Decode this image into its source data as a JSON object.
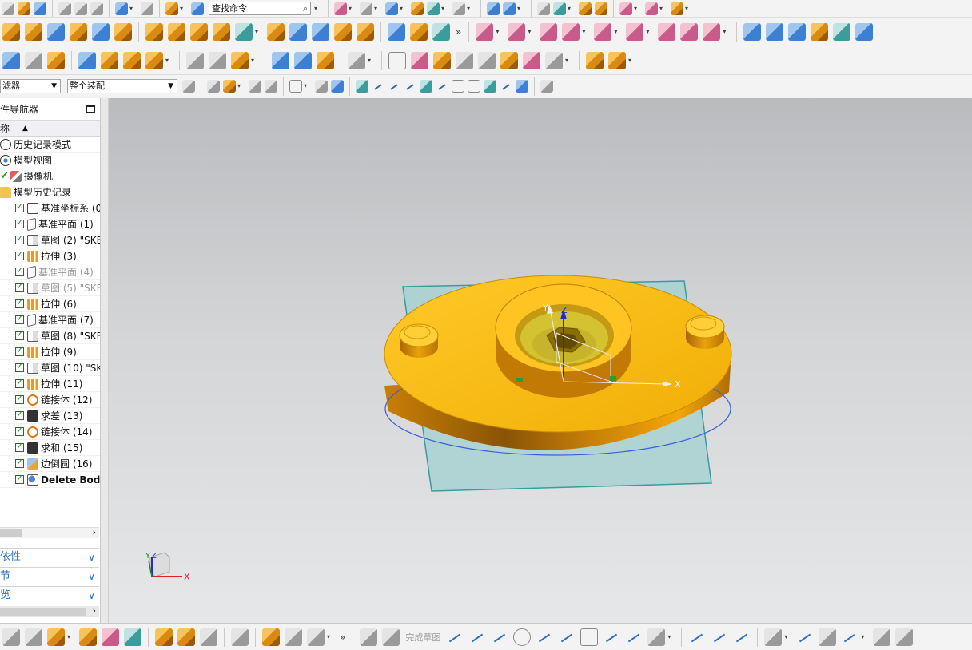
{
  "toolbar": {
    "search_placeholder": "查找命令",
    "filter_value": "滤器",
    "assembly_value": "整个装配",
    "finish_sketch_label": "完成草图",
    "more_glyph": "»"
  },
  "navigator": {
    "title": "件导航器",
    "column_name": "称",
    "top_items": [
      {
        "label": "历史记录模式"
      },
      {
        "label": "模型视图"
      },
      {
        "label": "摄像机"
      },
      {
        "label": "模型历史记录"
      }
    ],
    "features": [
      {
        "label": "基准坐标系 (0"
      },
      {
        "label": "基准平面 (1)"
      },
      {
        "label": "草图 (2) \"SKE"
      },
      {
        "label": "拉伸 (3)"
      },
      {
        "label": "基准平面 (4)"
      },
      {
        "label": "草图 (5) \"SKE"
      },
      {
        "label": "拉伸 (6)"
      },
      {
        "label": "基准平面 (7)"
      },
      {
        "label": "草图 (8) \"SKE"
      },
      {
        "label": "拉伸 (9)"
      },
      {
        "label": "草图 (10) \"SK"
      },
      {
        "label": "拉伸 (11)"
      },
      {
        "label": "链接体 (12)"
      },
      {
        "label": "求差 (13)"
      },
      {
        "label": "链接体 (14)"
      },
      {
        "label": "求和 (15)"
      },
      {
        "label": "边倒圆 (16)"
      },
      {
        "label": "Delete Body"
      }
    ],
    "panels": [
      {
        "label": "依性"
      },
      {
        "label": "节"
      },
      {
        "label": "览"
      }
    ]
  },
  "viewport": {
    "csys_labels": {
      "x": "X",
      "y": "Y",
      "z": "Z"
    },
    "triad_labels": {
      "x": "X",
      "y": "Y",
      "z": "Z"
    }
  },
  "colors": {
    "part_face": "#f5b90c",
    "part_side": "#d58e05",
    "plane_fill": "#a8d2d2",
    "plane_edge": "#3a9c9c",
    "selection_edge": "#3b5fd9"
  }
}
